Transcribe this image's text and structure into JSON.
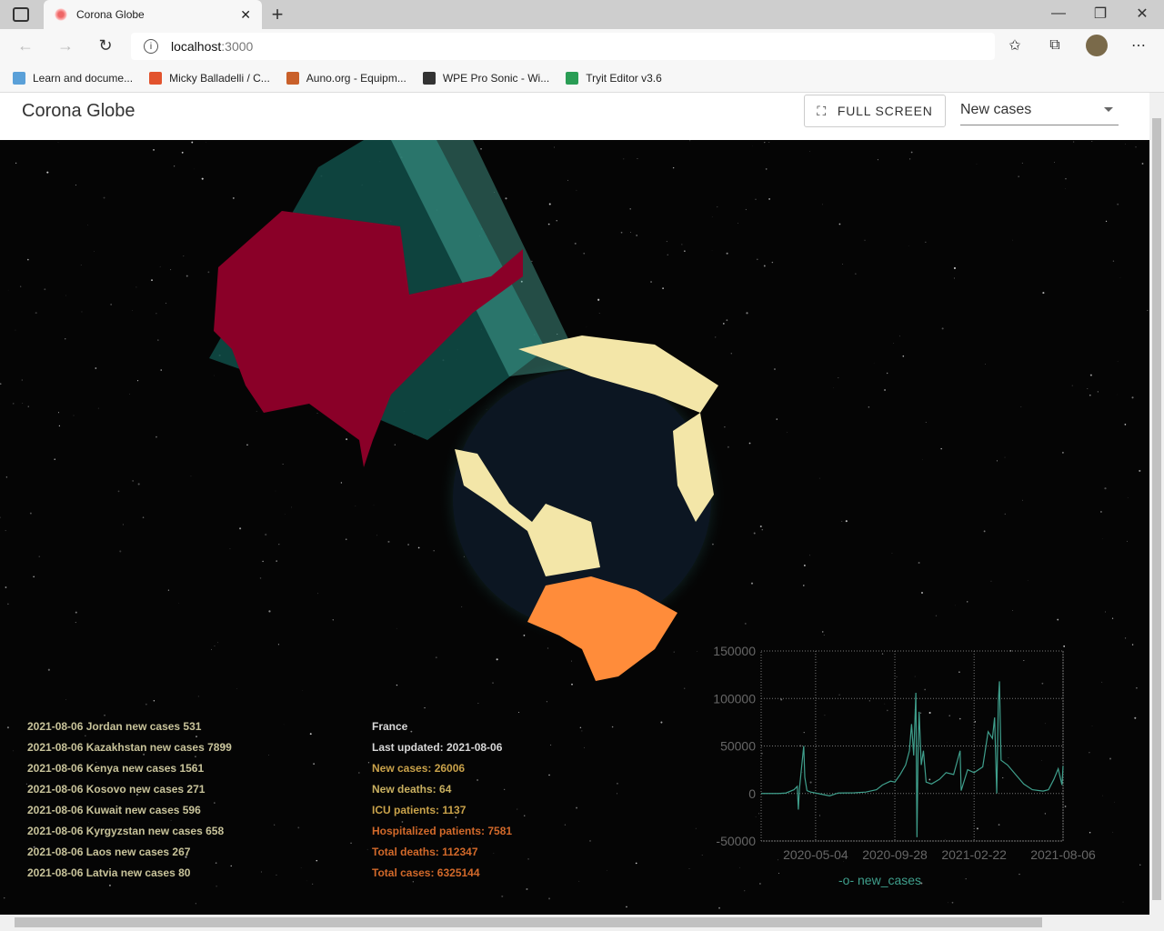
{
  "browser": {
    "tab_title": "Corona Globe",
    "url_host": "localhost",
    "url_port": ":3000",
    "bookmarks": [
      {
        "label": "Learn and docume...",
        "color": "#5aa0d8"
      },
      {
        "label": "Micky Balladelli / C...",
        "color": "#e2532d"
      },
      {
        "label": "Auno.org - Equipm...",
        "color": "#c9602a"
      },
      {
        "label": "WPE Pro Sonic - Wi...",
        "color": "#333333"
      },
      {
        "label": "Tryit Editor v3.6",
        "color": "#2a9d55"
      }
    ]
  },
  "app": {
    "title": "Corona Globe",
    "fullscreen_label": "FULL SCREEN",
    "metric_select": "New cases"
  },
  "feed": [
    "2021-08-06 Jordan new cases 531",
    "2021-08-06 Kazakhstan new cases 7899",
    "2021-08-06 Kenya new cases 1561",
    "2021-08-06 Kosovo new cases 271",
    "2021-08-06 Kuwait new cases 596",
    "2021-08-06 Kyrgyzstan new cases 658",
    "2021-08-06 Laos new cases 267",
    "2021-08-06 Latvia new cases 80"
  ],
  "country": {
    "name": "France",
    "last_updated": "Last updated: 2021-08-06",
    "new_cases": "New cases: 26006",
    "new_deaths": "New deaths: 64",
    "icu": "ICU patients: 1137",
    "hospitalized": "Hospitalized patients: 7581",
    "total_deaths": "Total deaths: 112347",
    "total_cases": "Total cases: 6325144"
  },
  "colors": {
    "highlight_country": "#8a0028",
    "brazil": "#ff8c3a",
    "series": "#3f9f8c",
    "info_white": "#d8d8d8",
    "info_gold": "#c9a24a",
    "info_orange": "#d2692a"
  },
  "chart_data": {
    "type": "line",
    "xlim": [
      "2020-01-24",
      "2021-08-06"
    ],
    "ylim": [
      -50000,
      150000
    ],
    "yticks": [
      "150000",
      "100000",
      "50000",
      "0",
      "-50000"
    ],
    "xticks": [
      "2020-05-04",
      "2020-09-28",
      "2021-02-22",
      "2021-08-06"
    ],
    "grid": true,
    "legend": "bottom",
    "series": [
      {
        "name": "new_cases",
        "points": [
          [
            "2020-01-24",
            0
          ],
          [
            "2020-02-25",
            0
          ],
          [
            "2020-03-10",
            500
          ],
          [
            "2020-03-25",
            4000
          ],
          [
            "2020-03-31",
            7500
          ],
          [
            "2020-04-02",
            -17000
          ],
          [
            "2020-04-04",
            5000
          ],
          [
            "2020-04-12",
            50000
          ],
          [
            "2020-04-14",
            17000
          ],
          [
            "2020-04-18",
            3000
          ],
          [
            "2020-04-25",
            1500
          ],
          [
            "2020-05-04",
            500
          ],
          [
            "2020-05-30",
            -2500
          ],
          [
            "2020-06-15",
            500
          ],
          [
            "2020-07-15",
            700
          ],
          [
            "2020-08-05",
            1500
          ],
          [
            "2020-08-25",
            4000
          ],
          [
            "2020-09-05",
            9000
          ],
          [
            "2020-09-20",
            13000
          ],
          [
            "2020-09-28",
            12000
          ],
          [
            "2020-10-08",
            20000
          ],
          [
            "2020-10-18",
            30000
          ],
          [
            "2020-10-25",
            45000
          ],
          [
            "2020-10-29",
            73000
          ],
          [
            "2020-11-02",
            40000
          ],
          [
            "2020-11-06",
            106000
          ],
          [
            "2020-11-08",
            -46000
          ],
          [
            "2020-11-10",
            40000
          ],
          [
            "2020-11-12",
            86000
          ],
          [
            "2020-11-16",
            30000
          ],
          [
            "2020-11-20",
            45000
          ],
          [
            "2020-11-25",
            12000
          ],
          [
            "2020-12-05",
            10000
          ],
          [
            "2020-12-20",
            15000
          ],
          [
            "2021-01-01",
            22000
          ],
          [
            "2021-01-15",
            20000
          ],
          [
            "2021-01-27",
            45000
          ],
          [
            "2021-01-29",
            3000
          ],
          [
            "2021-02-10",
            25000
          ],
          [
            "2021-02-22",
            22000
          ],
          [
            "2021-03-10",
            28000
          ],
          [
            "2021-03-20",
            65000
          ],
          [
            "2021-03-28",
            58000
          ],
          [
            "2021-04-01",
            80000
          ],
          [
            "2021-04-05",
            0
          ],
          [
            "2021-04-08",
            97000
          ],
          [
            "2021-04-10",
            118000
          ],
          [
            "2021-04-13",
            35000
          ],
          [
            "2021-04-25",
            30000
          ],
          [
            "2021-05-10",
            20000
          ],
          [
            "2021-05-25",
            10000
          ],
          [
            "2021-06-10",
            4000
          ],
          [
            "2021-06-30",
            2500
          ],
          [
            "2021-07-10",
            4000
          ],
          [
            "2021-07-20",
            15000
          ],
          [
            "2021-07-28",
            26000
          ],
          [
            "2021-08-04",
            9000
          ],
          [
            "2021-08-06",
            29000
          ]
        ]
      }
    ]
  }
}
